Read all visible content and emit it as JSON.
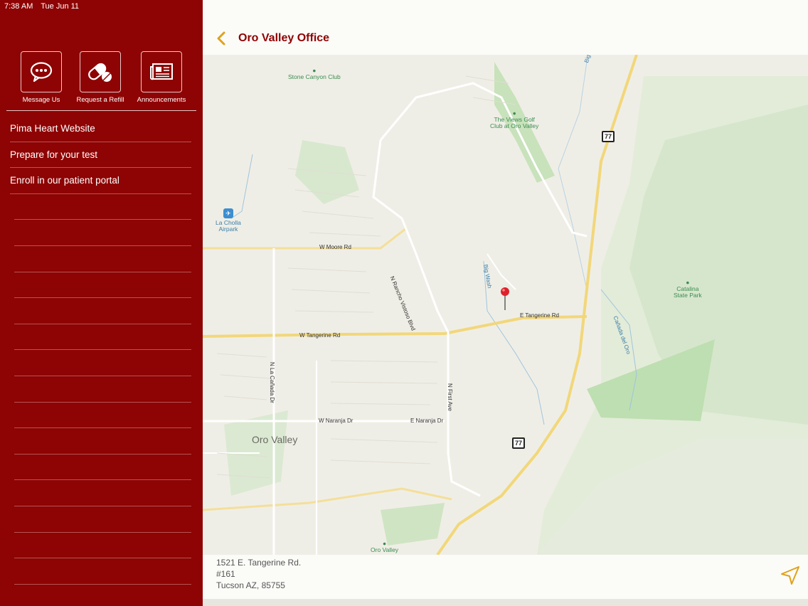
{
  "status_bar": {
    "time": "7:38 AM",
    "date": "Tue Jun 11"
  },
  "quick_actions": [
    {
      "label": "Message Us",
      "icon": "chat-bubble-icon"
    },
    {
      "label": "Request a Refill",
      "icon": "pill-icon"
    },
    {
      "label": "Announcements",
      "icon": "newspaper-icon"
    }
  ],
  "menu": [
    {
      "label": "Pima Heart Website"
    },
    {
      "label": "Prepare for your test"
    },
    {
      "label": "Enroll in our patient portal"
    }
  ],
  "header": {
    "title": "Oro Valley Office"
  },
  "map": {
    "labels": {
      "stone_canyon": "Stone Canyon Club",
      "views_golf": "The Views Golf\nClub at Oro Valley",
      "la_cholla": "La Cholla\nAirpark",
      "catalina": "Catalina\nState Park",
      "oro_valley_golf": "Oro Valley",
      "city": "Oro Valley",
      "w_moore": "W Moore Rd",
      "rancho_vistoso": "N Rancho Vistoso Blvd",
      "big_wash": "Big Wash",
      "big_wash_top": "Big W",
      "e_tangerine": "E Tangerine Rd",
      "w_tangerine": "W Tangerine Rd",
      "la_canada": "N La Cañada Dr",
      "first_ave": "N First Ave",
      "w_naranja": "W Naranja Dr",
      "e_naranja": "E Naranja Dr",
      "canada_del_oro": "Cañada del Oro",
      "route": "77"
    }
  },
  "address": {
    "line1": "1521 E. Tangerine Rd.",
    "line2": "#161",
    "line3": "Tucson AZ, 85755"
  },
  "colors": {
    "sidebar": "#8e0303",
    "title": "#8e0303",
    "accent": "#e0a21a"
  }
}
